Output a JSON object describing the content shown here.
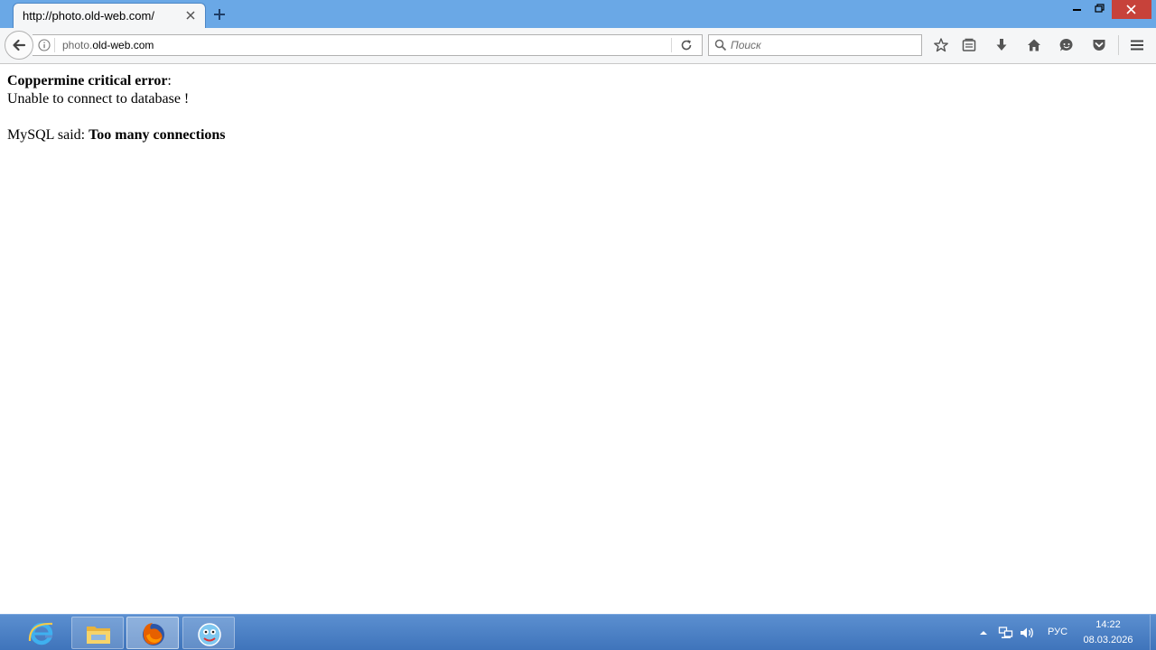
{
  "browser": {
    "tab": {
      "title": "http://photo.old-web.com/"
    },
    "urlbar": {
      "url_prefix": "photo.",
      "url_domain": "old-web.com"
    },
    "search": {
      "placeholder": "Поиск"
    },
    "icons": {
      "tab_close": "close-icon",
      "new_tab": "plus-icon",
      "back": "arrow-left-icon",
      "info": "info-icon",
      "reload": "reload-icon",
      "search": "search-icon",
      "bookmark": "star-icon",
      "library": "library-icon",
      "downloads": "download-icon",
      "home": "home-icon",
      "hello": "chat-icon",
      "pocket": "pocket-icon",
      "menu": "hamburger-icon"
    }
  },
  "page": {
    "error_title": "Coppermine critical error",
    "error_title_suffix": ":",
    "error_message": "Unable to connect to database !",
    "mysql_prefix": "MySQL said: ",
    "mysql_error": "Too many connections"
  },
  "taskbar": {
    "apps": [
      "internet-explorer",
      "file-explorer",
      "firefox",
      "custom-app"
    ],
    "tray": {
      "language": "РУС",
      "time": "14:22",
      "date": "08.03.2026"
    }
  },
  "colors": {
    "titlebar": "#6aa8e6",
    "close_button": "#c7423a",
    "taskbar": "#3f74bb"
  }
}
